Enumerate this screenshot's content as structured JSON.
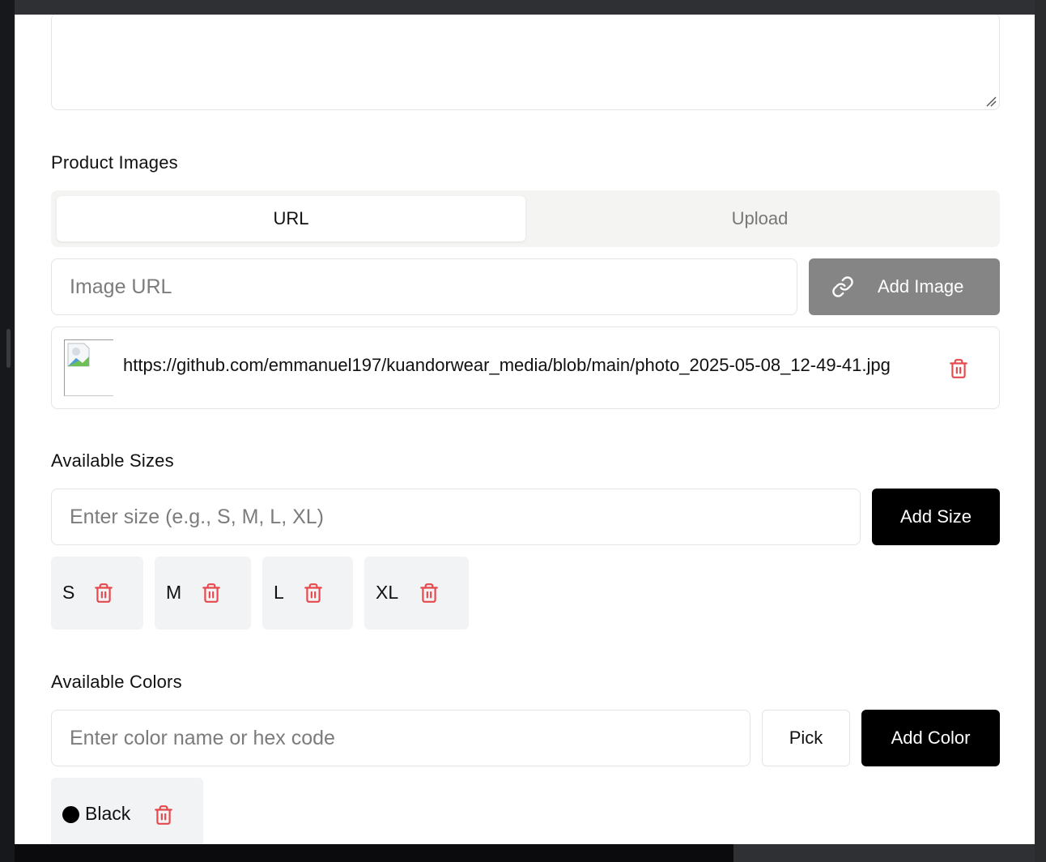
{
  "description_field": {
    "value": ""
  },
  "product_images": {
    "label": "Product Images",
    "tabs": [
      "URL",
      "Upload"
    ],
    "active_tab": "URL",
    "url_input": {
      "placeholder": "Image URL",
      "value": ""
    },
    "add_button_label": "Add Image",
    "images": [
      {
        "url": "https://github.com/emmanuel197/kuandorwear_media/blob/main/photo_2025-05-08_12-49-41.jpg"
      }
    ]
  },
  "available_sizes": {
    "label": "Available Sizes",
    "input": {
      "placeholder": "Enter size (e.g., S, M, L, XL)",
      "value": ""
    },
    "add_button_label": "Add Size",
    "sizes": [
      "S",
      "M",
      "L",
      "XL"
    ]
  },
  "available_colors": {
    "label": "Available Colors",
    "input": {
      "placeholder": "Enter color name or hex code",
      "value": ""
    },
    "pick_button_label": "Pick",
    "add_button_label": "Add Color",
    "colors": [
      {
        "name": "Black",
        "hex": "#000000"
      }
    ]
  },
  "icons": {
    "link": "link-icon",
    "delete": "trash-icon",
    "broken_image": "broken-image-icon"
  },
  "theme": {
    "danger": "#e5484d",
    "primary": "#000000",
    "disabled": "#858585"
  }
}
